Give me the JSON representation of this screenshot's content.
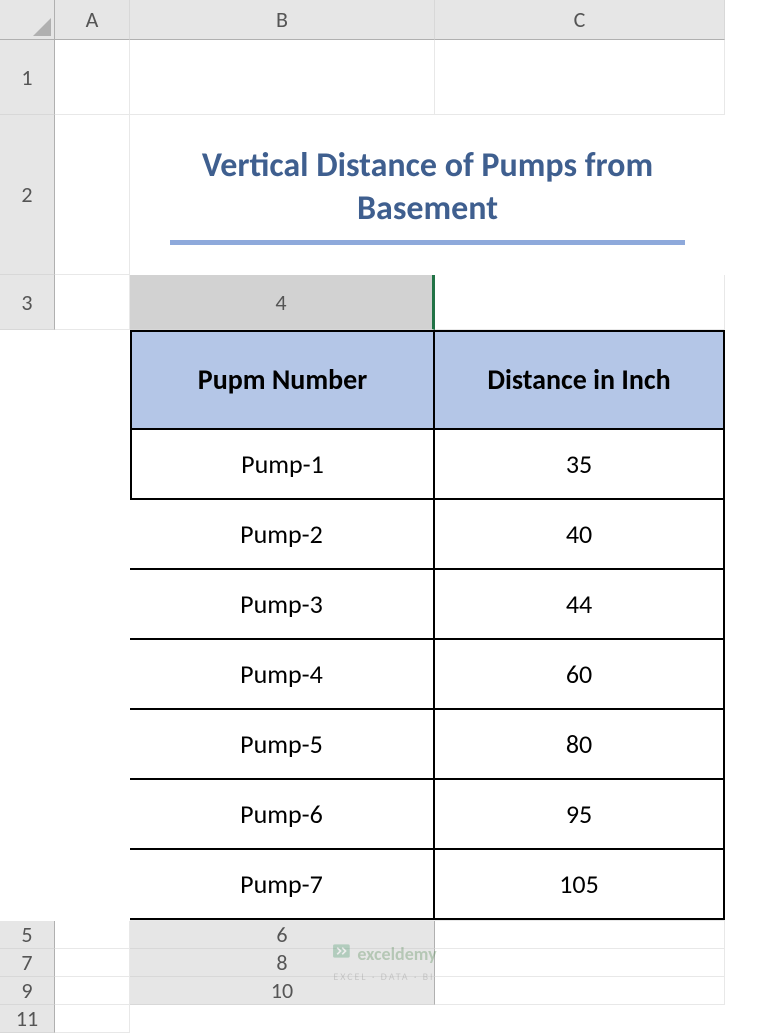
{
  "columns": [
    "A",
    "B",
    "C"
  ],
  "rows": [
    "1",
    "2",
    "3",
    "4",
    "5",
    "6",
    "7",
    "8",
    "9",
    "10",
    "11"
  ],
  "selected_row_index": 3,
  "title": "Vertical Distance of Pumps from Basement",
  "table": {
    "headers": [
      "Pupm Number",
      "Distance in Inch"
    ],
    "rows": [
      {
        "pump": "Pump-1",
        "dist": "35"
      },
      {
        "pump": "Pump-2",
        "dist": "40"
      },
      {
        "pump": "Pump-3",
        "dist": "44"
      },
      {
        "pump": "Pump-4",
        "dist": "60"
      },
      {
        "pump": "Pump-5",
        "dist": "80"
      },
      {
        "pump": "Pump-6",
        "dist": "95"
      },
      {
        "pump": "Pump-7",
        "dist": "105"
      }
    ]
  },
  "chart_data": {
    "type": "table",
    "title": "Vertical Distance of Pumps from Basement",
    "columns": [
      "Pupm Number",
      "Distance in Inch"
    ],
    "data": [
      [
        "Pump-1",
        35
      ],
      [
        "Pump-2",
        40
      ],
      [
        "Pump-3",
        44
      ],
      [
        "Pump-4",
        60
      ],
      [
        "Pump-5",
        80
      ],
      [
        "Pump-6",
        95
      ],
      [
        "Pump-7",
        105
      ]
    ]
  },
  "watermark": {
    "brand": "exceldemy",
    "sub": "EXCEL · DATA · BI"
  }
}
